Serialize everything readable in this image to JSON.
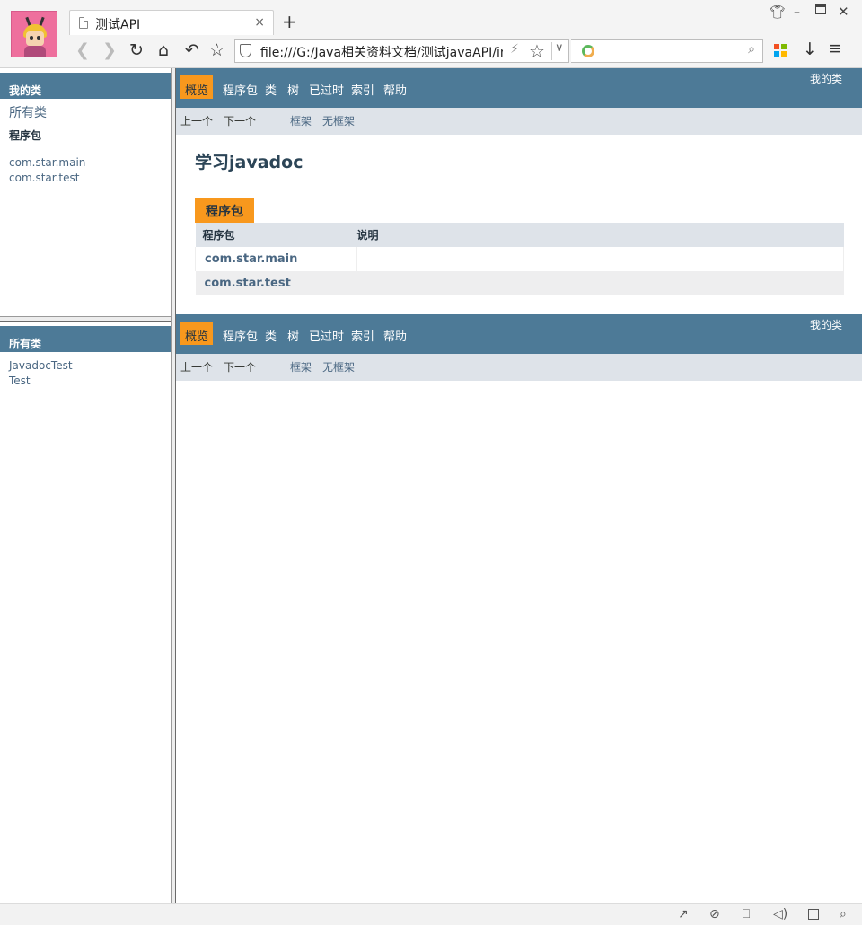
{
  "browser": {
    "tab_title": "测试API",
    "tab_close": "×",
    "new_tab": "+",
    "url": "file:///G:/Java相关资料文档/测试javaAPI/index.html",
    "search_value": "",
    "icons": [
      "restore-skin-icon",
      "minimize-icon",
      "maximize-icon",
      "close-icon",
      "back-icon",
      "forward-icon",
      "reload-icon",
      "home-icon",
      "undo-icon",
      "bookmark-icon",
      "shield-icon",
      "bolt-icon",
      "star-icon",
      "dropdown-icon",
      "search-engine-icon",
      "magnifier-icon",
      "apps-icon",
      "download-icon",
      "menu-icon"
    ],
    "apps_colors": [
      "#f25022",
      "#7fba00",
      "#00a4ef",
      "#ffb900"
    ]
  },
  "left": {
    "packages_header": "我的类",
    "all_classes_link": "所有类",
    "packages_title": "程序包",
    "packages": [
      "com.star.main",
      "com.star.test"
    ],
    "classes_header": "所有类",
    "classes": [
      "JavadocTest",
      "Test"
    ]
  },
  "right": {
    "nav": {
      "overview": "概览",
      "package": "程序包",
      "class": "类",
      "tree": "树",
      "deprecated": "已过时",
      "index": "索引",
      "help": "帮助",
      "doc_title": "我的类"
    },
    "subnav": {
      "prev": "上一个",
      "next": "下一个",
      "frames": "框架",
      "no_frames": "无框架"
    },
    "title": "学习javadoc",
    "table_caption": "程序包",
    "table_headers": {
      "package": "程序包",
      "description": "说明"
    },
    "rows": [
      {
        "package": "com.star.main",
        "description": ""
      },
      {
        "package": "com.star.test",
        "description": ""
      }
    ]
  },
  "statusbar_icons": [
    "pin-icon",
    "no-tracking-icon",
    "trash-icon",
    "sound-icon",
    "window-icon",
    "zoom-icon"
  ],
  "colors": {
    "nav_bg": "#4d7a97",
    "active_tab": "#f8981d",
    "subnav_bg": "#dee3e9",
    "link": "#4a6782"
  }
}
